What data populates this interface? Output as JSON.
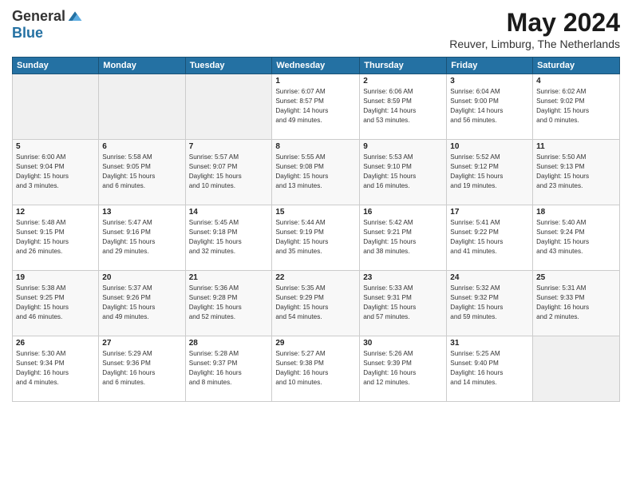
{
  "header": {
    "logo_general": "General",
    "logo_blue": "Blue",
    "month_title": "May 2024",
    "location": "Reuver, Limburg, The Netherlands"
  },
  "days_of_week": [
    "Sunday",
    "Monday",
    "Tuesday",
    "Wednesday",
    "Thursday",
    "Friday",
    "Saturday"
  ],
  "weeks": [
    [
      {
        "day": "",
        "info": ""
      },
      {
        "day": "",
        "info": ""
      },
      {
        "day": "",
        "info": ""
      },
      {
        "day": "1",
        "info": "Sunrise: 6:07 AM\nSunset: 8:57 PM\nDaylight: 14 hours\nand 49 minutes."
      },
      {
        "day": "2",
        "info": "Sunrise: 6:06 AM\nSunset: 8:59 PM\nDaylight: 14 hours\nand 53 minutes."
      },
      {
        "day": "3",
        "info": "Sunrise: 6:04 AM\nSunset: 9:00 PM\nDaylight: 14 hours\nand 56 minutes."
      },
      {
        "day": "4",
        "info": "Sunrise: 6:02 AM\nSunset: 9:02 PM\nDaylight: 15 hours\nand 0 minutes."
      }
    ],
    [
      {
        "day": "5",
        "info": "Sunrise: 6:00 AM\nSunset: 9:04 PM\nDaylight: 15 hours\nand 3 minutes."
      },
      {
        "day": "6",
        "info": "Sunrise: 5:58 AM\nSunset: 9:05 PM\nDaylight: 15 hours\nand 6 minutes."
      },
      {
        "day": "7",
        "info": "Sunrise: 5:57 AM\nSunset: 9:07 PM\nDaylight: 15 hours\nand 10 minutes."
      },
      {
        "day": "8",
        "info": "Sunrise: 5:55 AM\nSunset: 9:08 PM\nDaylight: 15 hours\nand 13 minutes."
      },
      {
        "day": "9",
        "info": "Sunrise: 5:53 AM\nSunset: 9:10 PM\nDaylight: 15 hours\nand 16 minutes."
      },
      {
        "day": "10",
        "info": "Sunrise: 5:52 AM\nSunset: 9:12 PM\nDaylight: 15 hours\nand 19 minutes."
      },
      {
        "day": "11",
        "info": "Sunrise: 5:50 AM\nSunset: 9:13 PM\nDaylight: 15 hours\nand 23 minutes."
      }
    ],
    [
      {
        "day": "12",
        "info": "Sunrise: 5:48 AM\nSunset: 9:15 PM\nDaylight: 15 hours\nand 26 minutes."
      },
      {
        "day": "13",
        "info": "Sunrise: 5:47 AM\nSunset: 9:16 PM\nDaylight: 15 hours\nand 29 minutes."
      },
      {
        "day": "14",
        "info": "Sunrise: 5:45 AM\nSunset: 9:18 PM\nDaylight: 15 hours\nand 32 minutes."
      },
      {
        "day": "15",
        "info": "Sunrise: 5:44 AM\nSunset: 9:19 PM\nDaylight: 15 hours\nand 35 minutes."
      },
      {
        "day": "16",
        "info": "Sunrise: 5:42 AM\nSunset: 9:21 PM\nDaylight: 15 hours\nand 38 minutes."
      },
      {
        "day": "17",
        "info": "Sunrise: 5:41 AM\nSunset: 9:22 PM\nDaylight: 15 hours\nand 41 minutes."
      },
      {
        "day": "18",
        "info": "Sunrise: 5:40 AM\nSunset: 9:24 PM\nDaylight: 15 hours\nand 43 minutes."
      }
    ],
    [
      {
        "day": "19",
        "info": "Sunrise: 5:38 AM\nSunset: 9:25 PM\nDaylight: 15 hours\nand 46 minutes."
      },
      {
        "day": "20",
        "info": "Sunrise: 5:37 AM\nSunset: 9:26 PM\nDaylight: 15 hours\nand 49 minutes."
      },
      {
        "day": "21",
        "info": "Sunrise: 5:36 AM\nSunset: 9:28 PM\nDaylight: 15 hours\nand 52 minutes."
      },
      {
        "day": "22",
        "info": "Sunrise: 5:35 AM\nSunset: 9:29 PM\nDaylight: 15 hours\nand 54 minutes."
      },
      {
        "day": "23",
        "info": "Sunrise: 5:33 AM\nSunset: 9:31 PM\nDaylight: 15 hours\nand 57 minutes."
      },
      {
        "day": "24",
        "info": "Sunrise: 5:32 AM\nSunset: 9:32 PM\nDaylight: 15 hours\nand 59 minutes."
      },
      {
        "day": "25",
        "info": "Sunrise: 5:31 AM\nSunset: 9:33 PM\nDaylight: 16 hours\nand 2 minutes."
      }
    ],
    [
      {
        "day": "26",
        "info": "Sunrise: 5:30 AM\nSunset: 9:34 PM\nDaylight: 16 hours\nand 4 minutes."
      },
      {
        "day": "27",
        "info": "Sunrise: 5:29 AM\nSunset: 9:36 PM\nDaylight: 16 hours\nand 6 minutes."
      },
      {
        "day": "28",
        "info": "Sunrise: 5:28 AM\nSunset: 9:37 PM\nDaylight: 16 hours\nand 8 minutes."
      },
      {
        "day": "29",
        "info": "Sunrise: 5:27 AM\nSunset: 9:38 PM\nDaylight: 16 hours\nand 10 minutes."
      },
      {
        "day": "30",
        "info": "Sunrise: 5:26 AM\nSunset: 9:39 PM\nDaylight: 16 hours\nand 12 minutes."
      },
      {
        "day": "31",
        "info": "Sunrise: 5:25 AM\nSunset: 9:40 PM\nDaylight: 16 hours\nand 14 minutes."
      },
      {
        "day": "",
        "info": ""
      }
    ]
  ]
}
